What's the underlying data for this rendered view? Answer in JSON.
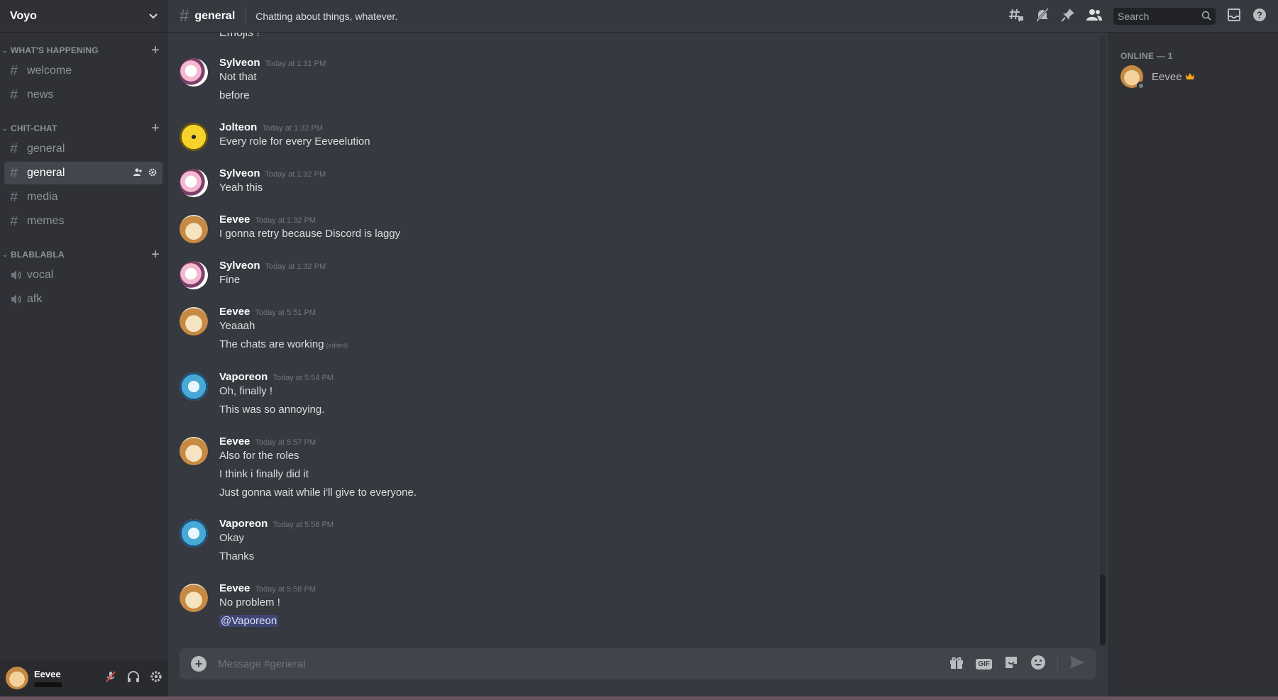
{
  "server": {
    "name": "Voyo"
  },
  "sidebar": {
    "categories": [
      {
        "name": "WHAT'S HAPPENING",
        "channels": [
          "welcome",
          "news"
        ]
      },
      {
        "name": "CHIT-CHAT",
        "channels": [
          "general",
          "general",
          "media",
          "memes"
        ]
      },
      {
        "name": "BLABLABLA",
        "channels": [
          "vocal",
          "afk"
        ]
      }
    ]
  },
  "header": {
    "channel": "general",
    "topic": "Chatting about things, whatever.",
    "search_placeholder": "Search"
  },
  "messages": {
    "partial": "Emojis !",
    "groups": [
      {
        "author": "Sylveon",
        "time": "Today at 1:31 PM",
        "lines": [
          "Not that",
          "before"
        ]
      },
      {
        "author": "Jolteon",
        "time": "Today at 1:32 PM",
        "lines": [
          "Every role for every Eeveelution"
        ]
      },
      {
        "author": "Sylveon",
        "time": "Today at 1:32 PM",
        "lines": [
          "Yeah this"
        ]
      },
      {
        "author": "Eevee",
        "time": "Today at 1:32 PM",
        "lines": [
          "I gonna retry because Discord is laggy"
        ]
      },
      {
        "author": "Sylveon",
        "time": "Today at 1:32 PM",
        "lines": [
          "Fine"
        ]
      },
      {
        "author": "Eevee",
        "time": "Today at 5:51 PM",
        "lines": [
          "Yeaaah",
          "The chats are working"
        ],
        "edited": "(edited)"
      },
      {
        "author": "Vaporeon",
        "time": "Today at 5:54 PM",
        "lines": [
          "Oh, finally !",
          "This was so annoying."
        ]
      },
      {
        "author": "Eevee",
        "time": "Today at 5:57 PM",
        "lines": [
          "Also for the roles",
          "I think i finally did it",
          "Just gonna wait while i'll give to everyone."
        ]
      },
      {
        "author": "Vaporeon",
        "time": "Today at 5:58 PM",
        "lines": [
          "Okay",
          "Thanks"
        ]
      },
      {
        "author": "Eevee",
        "time": "Today at 5:58 PM",
        "lines": [
          "No problem !"
        ],
        "mention": "@Vaporeon"
      }
    ]
  },
  "composer": {
    "placeholder": "Message #general",
    "gif_label": "GIF"
  },
  "members": {
    "heading": "ONLINE — 1",
    "list": [
      {
        "name": "Eevee",
        "badge": "crown-icon"
      }
    ]
  },
  "user_panel": {
    "name": "Eevee"
  },
  "icons": [
    "hash-icon",
    "bell-muted-icon",
    "pin-icon",
    "members-icon",
    "search-icon",
    "inbox-icon",
    "help-icon",
    "gift-icon",
    "sticker-icon",
    "emoji-icon",
    "send-icon",
    "mic-muted-icon",
    "headphones-icon",
    "gear-icon"
  ]
}
